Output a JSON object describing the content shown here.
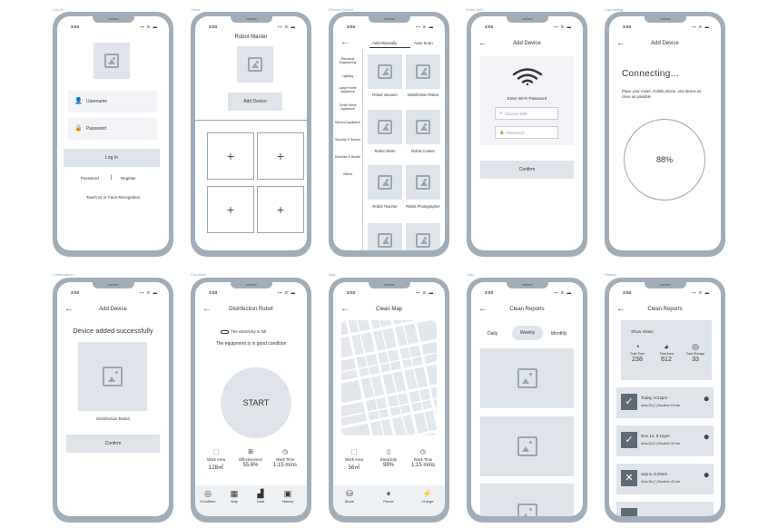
{
  "status": {
    "time": "3:03",
    "icons": "▪▪ ≋ ▬"
  },
  "screens": {
    "login": {
      "caption": "Log in",
      "username": "Username",
      "password": "Password",
      "login_btn": "Log In",
      "link_password": "Password",
      "divider": "|",
      "link_register": "Register",
      "touch_id": "Touch ID or Face Recognition"
    },
    "home": {
      "caption": "Home",
      "title": "Robot Master",
      "add_device": "Add Device",
      "plus": "+"
    },
    "choose": {
      "caption": "Choose Device",
      "tab_manual": "Add Manually",
      "tab_auto": "Auto Scan",
      "categories": [
        "Electrical Engineering",
        "Lighting",
        "Large Home Appliance",
        "Small Home Appliance",
        "Kitchen Appliance",
        "Security & Sensor",
        "Exercise & Health",
        "Others"
      ],
      "tiles": [
        "Robot Vacuum",
        "Disinfection Robot",
        "Robot Alarm",
        "Robot Cooker",
        "Robot Teacher",
        "Robot Photographer"
      ]
    },
    "wifi": {
      "caption": "Enter WiFi",
      "title": "Add Device",
      "prompt": "Enter Wi-Fi Password",
      "choose_wifi": "Choose WiFi",
      "password": "Password",
      "confirm": "Confirm"
    },
    "connecting": {
      "caption": "Connecting",
      "title": "Add Device",
      "heading": "Connecting...",
      "note": "Place your router, mobile phone, and device as close as possible",
      "progress": "88%"
    },
    "confirmation": {
      "caption": "Confirmation",
      "title": "Add Device",
      "success": "Device added successfully",
      "device": "Disinfection Robot",
      "confirm": "Confirm"
    },
    "condition": {
      "caption": "Condition",
      "title": "Disinfection Robot",
      "electricity": "The electricity is full",
      "status": "The equipment is in good condition",
      "start": "START",
      "stats": [
        {
          "label": "Work Area",
          "value": "128㎡"
        },
        {
          "label": "Effectiveness",
          "value": "55.6%"
        },
        {
          "label": "Work Time",
          "value": "1:15 mins"
        }
      ],
      "tabs": [
        "Condition",
        "Map",
        "Data",
        "History"
      ]
    },
    "map": {
      "caption": "Map",
      "title": "Clean Map",
      "stats": [
        {
          "label": "Work Area",
          "value": "56㎡"
        },
        {
          "label": "Electricity",
          "value": "98%"
        },
        {
          "label": "Work Time",
          "value": "1:15 mins"
        }
      ],
      "tabs": [
        "Mode",
        "Pause",
        "Charge"
      ]
    },
    "data": {
      "caption": "Data",
      "title": "Clean Reports",
      "tabs": [
        "Daily",
        "Weekly",
        "Monthly"
      ],
      "active_tab": "Weekly"
    },
    "history": {
      "caption": "History",
      "title": "Clean Reports",
      "show_views": "Show Views",
      "totals": [
        {
          "label": "Total Time",
          "value": "238"
        },
        {
          "label": "Total Area",
          "value": "612"
        },
        {
          "label": "Total Storage",
          "value": "33"
        }
      ],
      "records": [
        {
          "date": "Today, 9:22pm",
          "detail": "Area 22㎡ | Duration 10 min",
          "ok": true
        },
        {
          "date": "Nov 12, 8:12pm",
          "detail": "Area 22㎡ | Duration 30 min",
          "ok": true
        },
        {
          "date": "Sep 6, 6:20am",
          "detail": "Area 30㎡ | Duration 40 min",
          "ok": false
        }
      ]
    }
  },
  "colors": {
    "frame": "#a1adb8",
    "placeholder": "#dfe4ea",
    "field": "#f1f3f6"
  }
}
